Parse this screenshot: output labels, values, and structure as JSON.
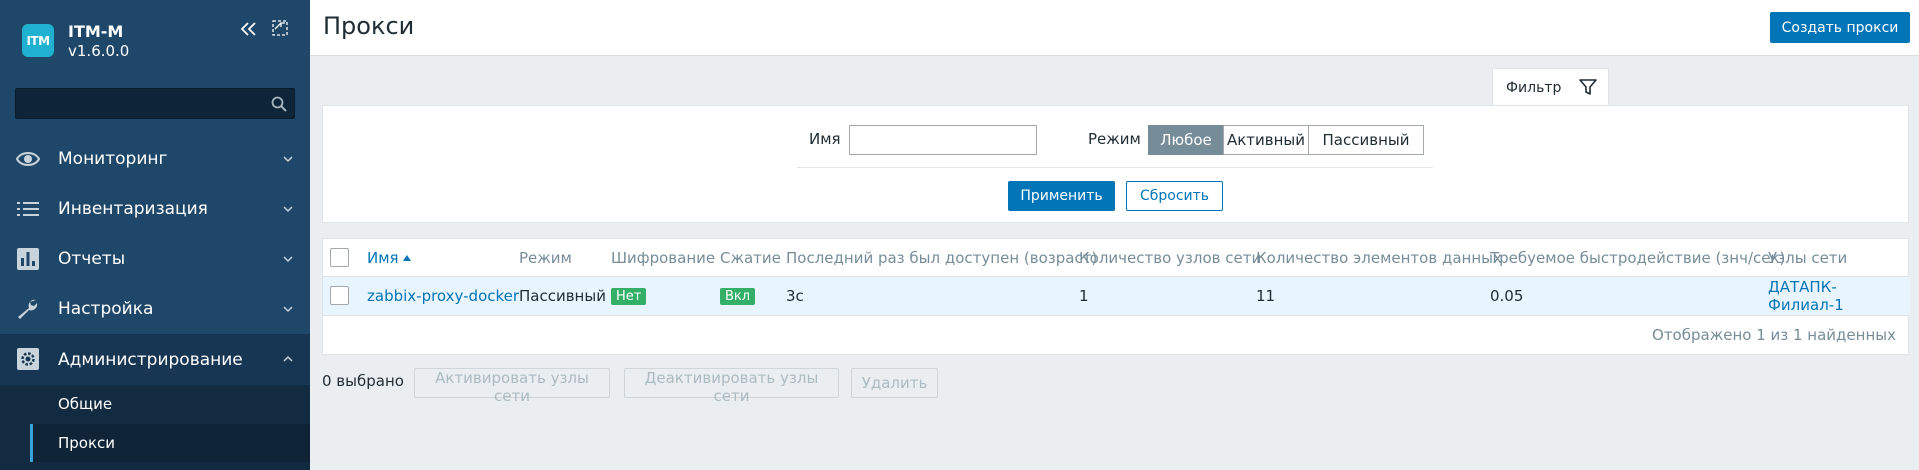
{
  "app": {
    "logo_text": "ITM",
    "name": "ITM-M",
    "version": "v1.6.0.0"
  },
  "search": {
    "placeholder": ""
  },
  "menu": [
    {
      "id": "monitoring",
      "label": "Мониторинг",
      "icon": "eye-icon",
      "expanded": false
    },
    {
      "id": "inventory",
      "label": "Инвентаризация",
      "icon": "list-icon",
      "expanded": false
    },
    {
      "id": "reports",
      "label": "Отчеты",
      "icon": "bar-chart-icon",
      "expanded": false
    },
    {
      "id": "settings",
      "label": "Настройка",
      "icon": "wrench-icon",
      "expanded": false
    },
    {
      "id": "admin",
      "label": "Администрирование",
      "icon": "cog-icon",
      "expanded": true
    }
  ],
  "submenu": [
    {
      "label": "Общие",
      "selected": false
    },
    {
      "label": "Прокси",
      "selected": true
    }
  ],
  "header": {
    "title": "Прокси",
    "create_button": "Создать прокси"
  },
  "filter": {
    "tab_label": "Фильтр",
    "name_label": "Имя",
    "name_value": "",
    "mode_label": "Режим",
    "mode_options": [
      "Любое",
      "Активный",
      "Пассивный"
    ],
    "mode_selected": "Любое",
    "apply_label": "Применить",
    "reset_label": "Сбросить"
  },
  "table": {
    "columns": [
      "Имя",
      "Режим",
      "Шифрование",
      "Сжатие",
      "Последний раз был доступен (возраст)",
      "Количество узлов сети",
      "Количество элементов данных",
      "Требуемое быстродействие (знч/сек)",
      "Узлы сети"
    ],
    "rows": [
      {
        "name": "zabbix-proxy-docker",
        "mode": "Пассивный",
        "encryption": "Нет",
        "compression": "Вкл",
        "last_seen": "3с",
        "hosts_count": "1",
        "items_count": "11",
        "nvps": "0.05",
        "hosts": "ДАТАПК-Филиал-1"
      }
    ],
    "footer": "Отображено 1 из 1 найденных"
  },
  "actions": {
    "selected_count": "0 выбрано",
    "enable_hosts": "Активировать узлы сети",
    "disable_hosts": "Деактивировать узлы сети",
    "delete": "Удалить"
  },
  "colors": {
    "sidebar_bg": "#1f4769",
    "accent": "#0275b8",
    "badge_green": "#34af67",
    "row_highlight": "#e8f5ff"
  }
}
